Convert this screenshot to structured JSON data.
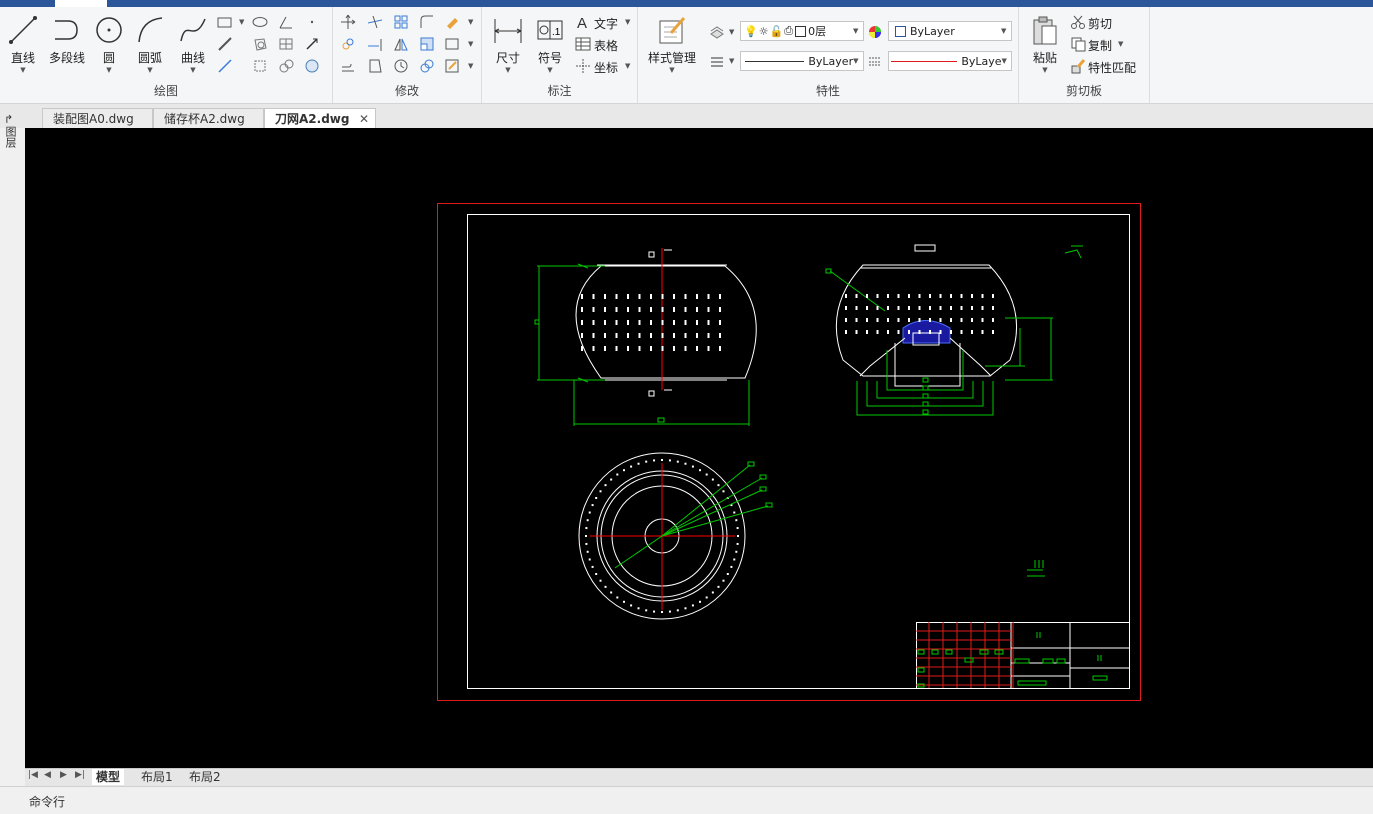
{
  "ribbon": {
    "draw_group": {
      "label": "绘图",
      "line": "直线",
      "polyline": "多段线",
      "circle": "圆",
      "arc": "圆弧",
      "curve": "曲线"
    },
    "modify_group": {
      "label": "修改"
    },
    "annotate_group": {
      "label": "标注",
      "dimension": "尺寸",
      "symbol": "符号",
      "text": "文字",
      "table": "表格",
      "coordinate": "坐标"
    },
    "properties_group": {
      "label": "特性",
      "style_manager": "样式管理",
      "layer_value": "0层",
      "color_value": "ByLayer",
      "linetype_value": "ByLayer",
      "lineweight_value": "ByLaye"
    },
    "clipboard_group": {
      "label": "剪切板",
      "paste": "粘贴",
      "cut": "剪切",
      "copy": "复制",
      "match_props": "特性匹配"
    }
  },
  "doc_tabs": [
    {
      "label": "装配图A0.dwg"
    },
    {
      "label": "储存杯A2.dwg"
    },
    {
      "label": "刀网A2.dwg",
      "active": true
    }
  ],
  "side": {
    "label": "图层"
  },
  "layout_tabs": [
    {
      "label": "模型",
      "active": true
    },
    {
      "label": "布局1"
    },
    {
      "label": "布局2"
    }
  ],
  "command_line": {
    "label": "命令行"
  },
  "colors": {
    "ribbon_accent": "#2b579a",
    "border_red": "#e01b1b",
    "dim_green": "#00c800",
    "center_red": "#ff0000",
    "hatch_blue": "#1a1aa0"
  }
}
